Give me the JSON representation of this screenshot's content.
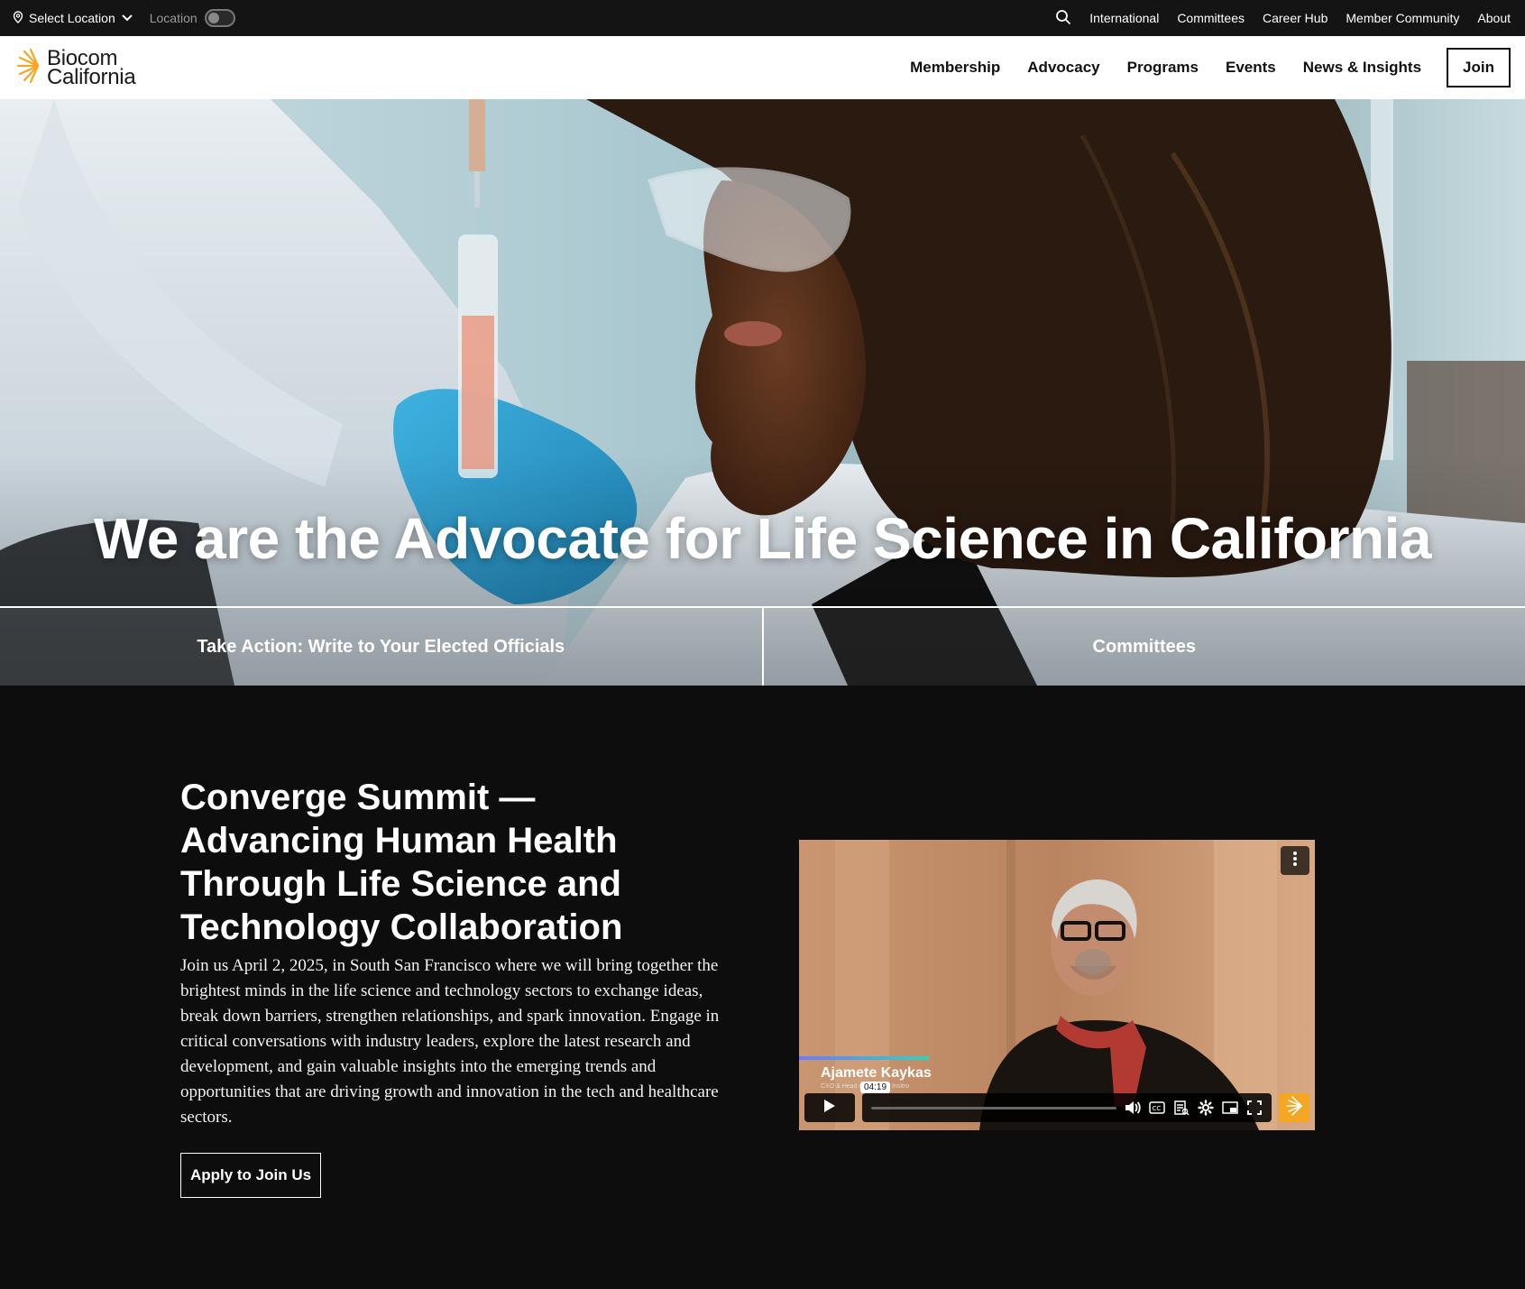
{
  "utility_bar": {
    "select_location": "Select Location",
    "location_toggle_label": "Location",
    "links": [
      "International",
      "Committees",
      "Career Hub",
      "Member Community",
      "About"
    ]
  },
  "header": {
    "logo_line1": "Biocom",
    "logo_line2": "California",
    "nav": [
      "Membership",
      "Advocacy",
      "Programs",
      "Events",
      "News & Insights"
    ],
    "join_label": "Join"
  },
  "hero": {
    "title": "We are the Advocate for Life Science in California",
    "actions": [
      "Take Action: Write to Your Elected Officials",
      "Committees"
    ]
  },
  "summit": {
    "title": "Converge Summit — Advancing Human Health Through Life Science and Technology Collaboration",
    "body": "Join us April 2, 2025, in South San Francisco where we will bring together the brightest minds in the life science and technology sectors to exchange ideas, break down barriers, strengthen relationships, and spark innovation. Engage in critical conversations with industry leaders, explore the latest research and development, and gain valuable insights into the emerging trends and opportunities that are driving growth and innovation in the tech and healthcare sectors.",
    "apply_label": "Apply to Join Us"
  },
  "video": {
    "speaker_name": "Ajamete Kaykas",
    "speaker_role": "CXO & Head of Science, Insitro",
    "time_tooltip": "04:19"
  },
  "colors": {
    "brand_orange": "#f5a623",
    "dark_bg": "#0d0d0d",
    "utility_bg": "#141414"
  }
}
